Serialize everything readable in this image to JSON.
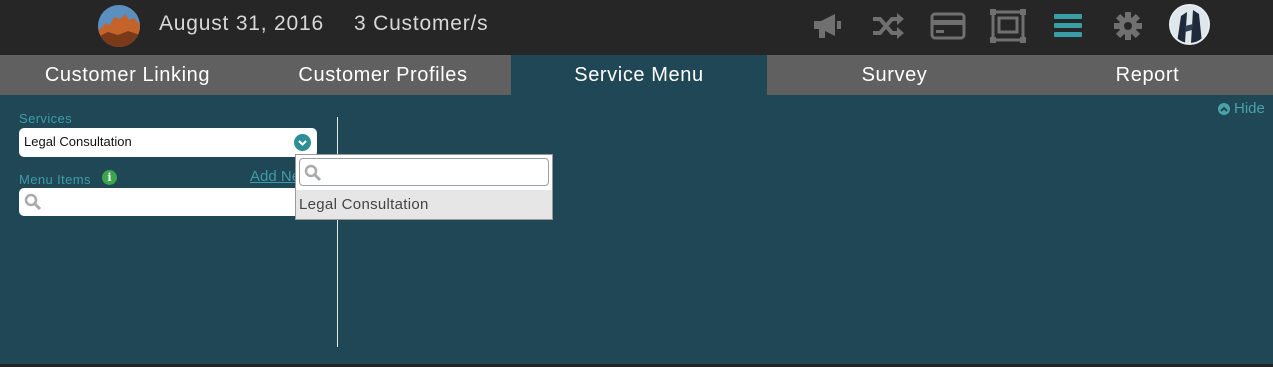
{
  "header": {
    "date": "August 31, 2016",
    "customers": "3 Customer/s"
  },
  "tabs": [
    {
      "label": "Customer Linking"
    },
    {
      "label": "Customer Profiles"
    },
    {
      "label": "Service Menu",
      "active": true
    },
    {
      "label": "Survey"
    },
    {
      "label": "Report"
    }
  ],
  "sidebar": {
    "hide_label": "Hide",
    "services_label": "Services",
    "services_selected": "Legal Consultation",
    "menu_items_label": "Menu Items",
    "add_new_label": "Add New",
    "menu_search_placeholder": ""
  },
  "dropdown": {
    "search_placeholder": "",
    "options": [
      "Legal Consultation"
    ]
  },
  "colors": {
    "accent": "#2e8f96",
    "panel": "#1f4756",
    "topbar": "#262626",
    "tabbar": "#606060"
  }
}
